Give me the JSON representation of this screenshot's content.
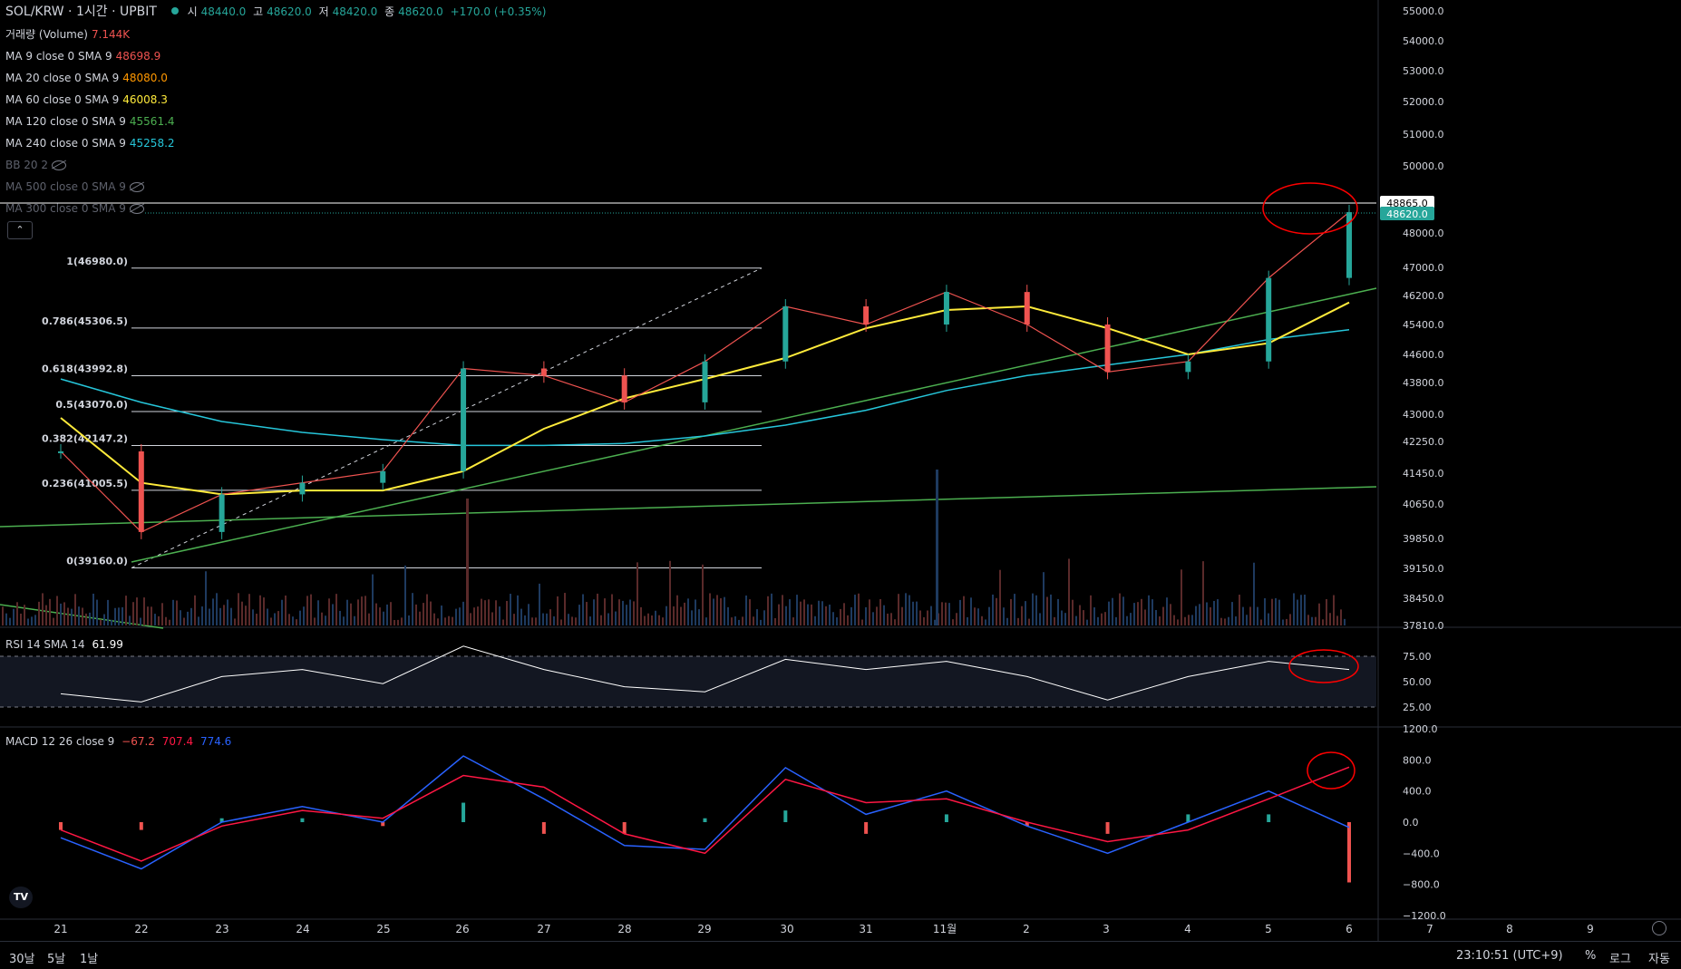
{
  "header": {
    "symbol": "SOL/KRW · 1시간 · UPBIT",
    "open_label": "시",
    "open": "48440.0",
    "high_label": "고",
    "high": "48620.0",
    "low_label": "저",
    "low": "48420.0",
    "close_label": "종",
    "close": "48620.0",
    "change": "+170.0 (+0.35%)"
  },
  "indicators": [
    {
      "label": "거래량 (Volume)",
      "value": "7.144K",
      "color": "#ef5350",
      "hidden": false
    },
    {
      "label": "MA 9 close 0 SMA 9",
      "value": "48698.9",
      "color": "#ef5350",
      "hidden": false
    },
    {
      "label": "MA 20 close 0 SMA 9",
      "value": "48080.0",
      "color": "#ff9800",
      "hidden": false
    },
    {
      "label": "MA 60 close 0 SMA 9",
      "value": "46008.3",
      "color": "#ffeb3b",
      "hidden": false
    },
    {
      "label": "MA 120 close 0 SMA 9",
      "value": "45561.4",
      "color": "#4caf50",
      "hidden": false
    },
    {
      "label": "MA 240 close 0 SMA 9",
      "value": "45258.2",
      "color": "#26c6da",
      "hidden": false
    },
    {
      "label": "BB 20 2",
      "value": "",
      "color": "#787b86",
      "hidden": true
    },
    {
      "label": "MA 500 close 0 SMA 9",
      "value": "",
      "color": "#787b86",
      "hidden": true
    },
    {
      "label": "MA 300 close 0 SMA 9",
      "value": "",
      "color": "#787b86",
      "hidden": true
    }
  ],
  "price_axis": {
    "ticks": [
      "55000.0",
      "54000.0",
      "53000.0",
      "52000.0",
      "51000.0",
      "50000.0",
      "48000.0",
      "47000.0",
      "46200.0",
      "45400.0",
      "44600.0",
      "43800.0",
      "43000.0",
      "42250.0",
      "41450.0",
      "40650.0",
      "39850.0",
      "39150.0",
      "38450.0",
      "37810.0"
    ],
    "tick_values": [
      55000,
      54000,
      53000,
      52000,
      51000,
      50000,
      48000,
      47000,
      46200,
      45400,
      44600,
      43800,
      43000,
      42250,
      41450,
      40650,
      39850,
      39150,
      38450,
      37810
    ],
    "label_hline": "48865.0",
    "label_last": "48620.0"
  },
  "rsi": {
    "label": "RSI 14 SMA 14",
    "value": "61.99",
    "ticks": [
      "75.00",
      "50.00",
      "25.00"
    ]
  },
  "macd": {
    "label": "MACD 12 26 close 9",
    "macd": "−67.2",
    "signal": "707.4",
    "hist": "774.6",
    "ticks": [
      "1200.0",
      "800.0",
      "400.0",
      "0.0",
      "−400.0",
      "−800.0",
      "−1200.0"
    ]
  },
  "time_axis": [
    "21",
    "22",
    "23",
    "24",
    "25",
    "26",
    "27",
    "28",
    "29",
    "30",
    "31",
    "11월",
    "2",
    "3",
    "4",
    "5",
    "6",
    "7",
    "8",
    "9"
  ],
  "fib_levels": [
    {
      "label": "1(46980.0)",
      "value": 46980
    },
    {
      "label": "0.786(45306.5)",
      "value": 45306.5
    },
    {
      "label": "0.618(43992.8)",
      "value": 43992.8
    },
    {
      "label": "0.5(43070.0)",
      "value": 43070
    },
    {
      "label": "0.382(42147.2)",
      "value": 42147.2
    },
    {
      "label": "0.236(41005.5)",
      "value": 41005.5
    },
    {
      "label": "0(39160.0)",
      "value": 39160
    }
  ],
  "bottom": {
    "ranges": [
      "30날",
      "5날",
      "1날"
    ],
    "time": "23:10:51 (UTC+9)",
    "percent": "%",
    "log": "로그",
    "auto": "자동"
  },
  "tv_logo": "TV",
  "chart_data": {
    "type": "line",
    "title": "SOL/KRW · 1시간 · UPBIT",
    "x": [
      "21",
      "22",
      "23",
      "24",
      "25",
      "26",
      "27",
      "28",
      "29",
      "30",
      "31",
      "11월",
      "2",
      "3",
      "4",
      "5",
      "6"
    ],
    "series": [
      {
        "name": "close",
        "values": [
          42000,
          40000,
          40900,
          41200,
          41500,
          44200,
          44000,
          43300,
          44400,
          45900,
          45400,
          46300,
          45400,
          44100,
          44400,
          46700,
          48620
        ]
      },
      {
        "name": "MA 60 close 0 SMA 9",
        "values": [
          42900,
          41200,
          40900,
          41000,
          41000,
          41500,
          42600,
          43400,
          43900,
          44500,
          45300,
          45800,
          45900,
          45300,
          44600,
          44900,
          46008.3
        ]
      },
      {
        "name": "MA 240 close 0 SMA 9",
        "values": [
          43900,
          43300,
          42800,
          42500,
          42300,
          42150,
          42150,
          42200,
          42400,
          42700,
          43100,
          43600,
          44000,
          44300,
          44600,
          45000,
          45258.2
        ]
      }
    ],
    "ylim": [
      37810,
      55000
    ],
    "rsi_values": [
      38,
      30,
      55,
      62,
      48,
      85,
      62,
      45,
      40,
      72,
      62,
      70,
      55,
      32,
      55,
      70,
      61.99
    ],
    "rsi_ylim": [
      0,
      100
    ],
    "macd_values": [
      -200,
      -600,
      0,
      200,
      0,
      850,
      300,
      -300,
      -350,
      700,
      100,
      400,
      -50,
      -400,
      0,
      400,
      -67.2
    ],
    "signal_values": [
      -100,
      -500,
      -50,
      150,
      50,
      600,
      450,
      -150,
      -400,
      550,
      250,
      300,
      0,
      -250,
      -100,
      300,
      707.4
    ],
    "macd_ylim": [
      -1200,
      1200
    ]
  },
  "colors": {
    "up": "#26a69a",
    "down": "#ef5350",
    "ma9": "#ef5350",
    "ma20": "#ff9800",
    "ma60": "#ffeb3b",
    "ma120": "#4caf50",
    "ma240": "#26c6da",
    "trend": "#4caf50",
    "rsi": "#ffffff",
    "macd": "#2962ff",
    "signal": "#ff1744",
    "annotation": "#ff0000",
    "last_price": "#26a69a"
  }
}
